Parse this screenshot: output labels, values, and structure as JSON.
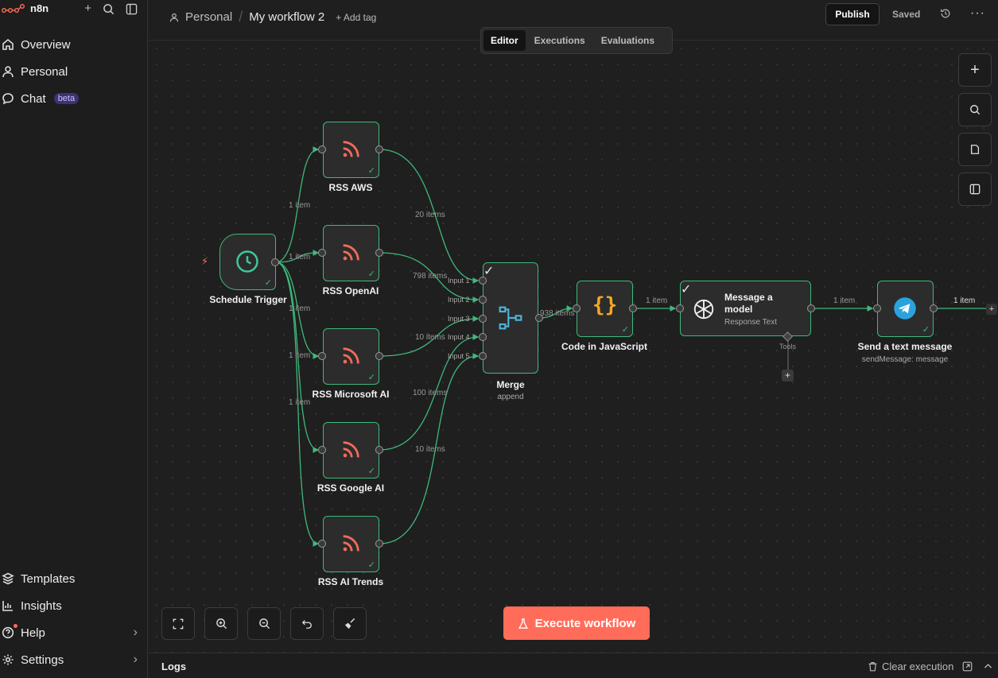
{
  "app": {
    "name": "n8n"
  },
  "sidebar": {
    "items": [
      {
        "label": "Overview"
      },
      {
        "label": "Personal"
      },
      {
        "label": "Chat",
        "badge": "beta"
      }
    ],
    "bottom": [
      {
        "label": "Templates"
      },
      {
        "label": "Insights"
      },
      {
        "label": "Help"
      },
      {
        "label": "Settings"
      }
    ]
  },
  "header": {
    "project": "Personal",
    "workflow": "My workflow 2",
    "add_tag": "+ Add tag",
    "publish": "Publish",
    "saved": "Saved"
  },
  "tabs": [
    "Editor",
    "Executions",
    "Evaluations"
  ],
  "nodes": {
    "schedule": {
      "label": "Schedule Trigger"
    },
    "rss_aws": {
      "label": "RSS AWS"
    },
    "rss_openai": {
      "label": "RSS OpenAI"
    },
    "rss_microsoft": {
      "label": "RSS Microsoft AI"
    },
    "rss_google": {
      "label": "RSS Google AI"
    },
    "rss_trends": {
      "label": "RSS AI Trends"
    },
    "merge": {
      "label": "Merge",
      "sub": "append",
      "inputs": [
        "Input 1",
        "Input 2",
        "Input 3",
        "Input 4",
        "Input 5"
      ]
    },
    "code": {
      "label": "Code in JavaScript"
    },
    "model": {
      "title_line1": "Message a",
      "title_line2": "model",
      "sub": "Response Text",
      "tools": "Tools"
    },
    "telegram": {
      "label": "Send a text message",
      "sub": "sendMessage: message"
    }
  },
  "edges": {
    "trigger_1": "1 item",
    "trigger_2": "1 item",
    "trigger_3": "1 item",
    "trigger_4": "1 item",
    "trigger_5": "1 item",
    "aws": "20 items",
    "openai": "798 items",
    "microsoft": "10 items",
    "google": "100 items",
    "trends": "10 items",
    "merge_out": "938 items",
    "code_out": "1 item",
    "model_out": "1 item",
    "telegram_out": "1 item"
  },
  "execute_button": "Execute workflow",
  "logs": {
    "title": "Logs",
    "clear": "Clear execution"
  },
  "colors": {
    "accent": "#ff6d5a",
    "success": "#3fb97a",
    "rss": "#f26b5b",
    "code": "#f5a623",
    "telegram": "#2aa3dd"
  }
}
